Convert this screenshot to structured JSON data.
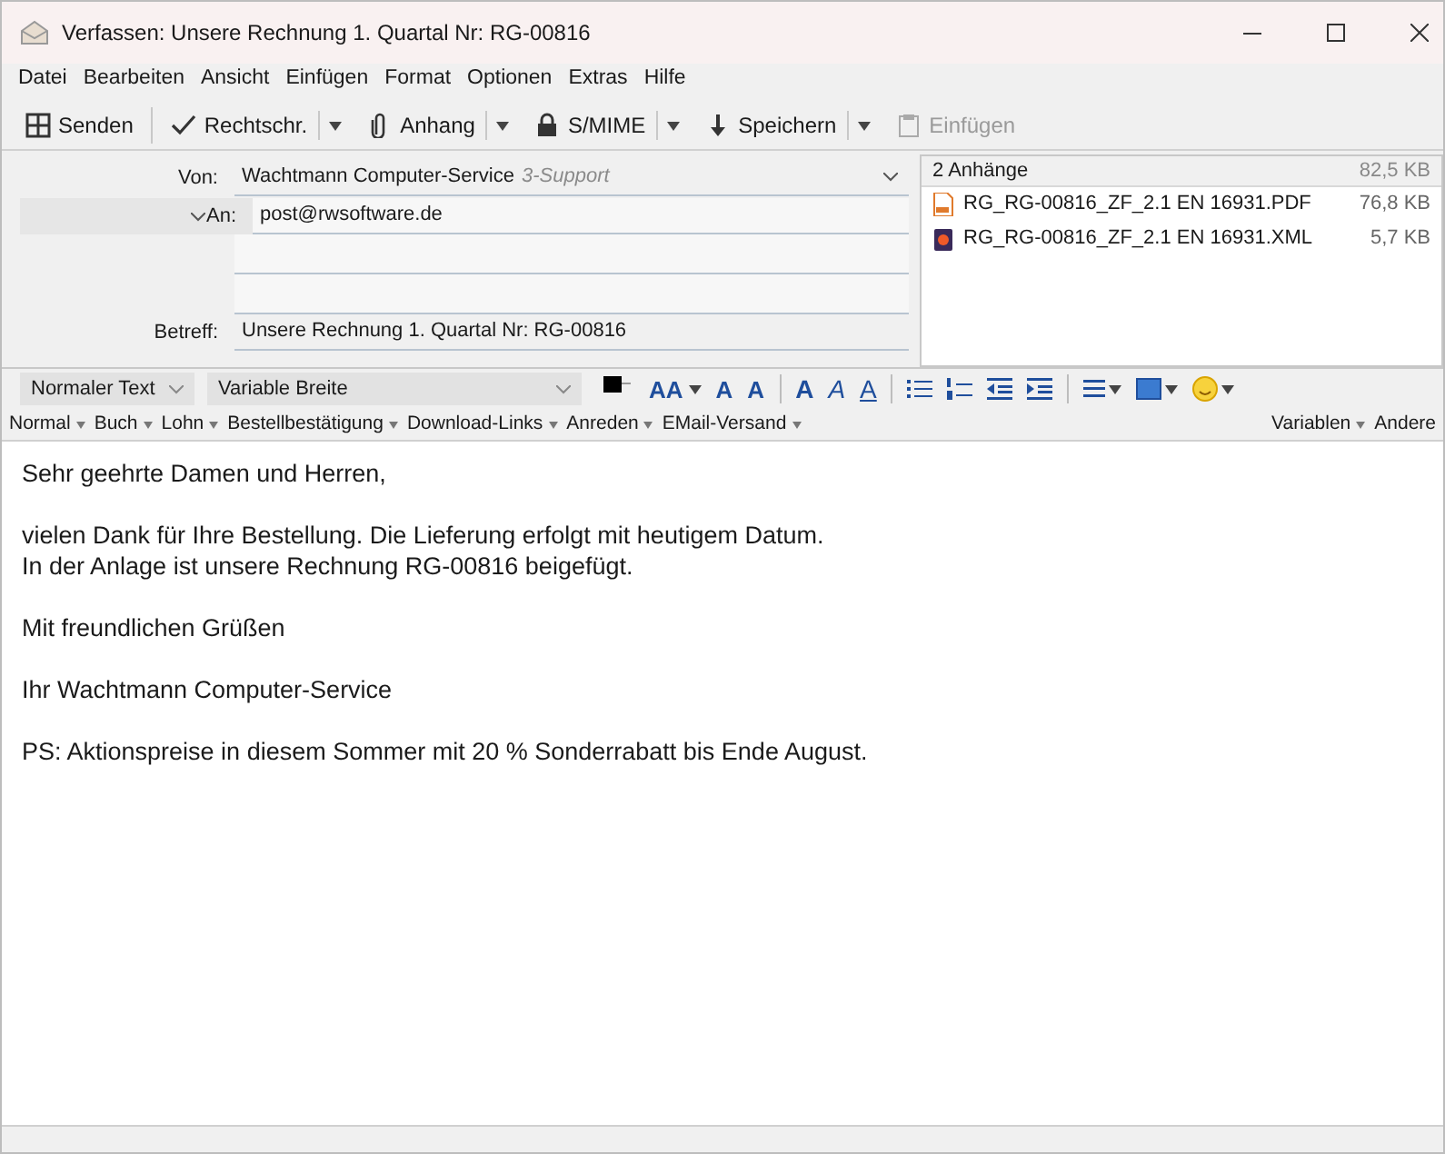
{
  "window": {
    "title": "Verfassen: Unsere Rechnung 1. Quartal Nr: RG-00816"
  },
  "menu": [
    "Datei",
    "Bearbeiten",
    "Ansicht",
    "Einfügen",
    "Format",
    "Optionen",
    "Extras",
    "Hilfe"
  ],
  "toolbar": [
    {
      "kind": "send",
      "label": "Senden",
      "dropdown": false,
      "disabled": false
    },
    {
      "kind": "spell",
      "label": "Rechtschr.",
      "dropdown": true,
      "disabled": false
    },
    {
      "kind": "attach",
      "label": "Anhang",
      "dropdown": true,
      "disabled": false
    },
    {
      "kind": "lock",
      "label": "S/MIME",
      "dropdown": true,
      "disabled": false
    },
    {
      "kind": "save",
      "label": "Speichern",
      "dropdown": true,
      "disabled": false
    },
    {
      "kind": "paste",
      "label": "Einfügen",
      "dropdown": false,
      "disabled": true
    }
  ],
  "header": {
    "from_label": "Von:",
    "from": "Wachtmann Computer-Service",
    "from_identity": "3-Support",
    "to_label": "An:",
    "to": "post@rwsoftware.de",
    "subject_label": "Betreff:",
    "subject": "Unsere Rechnung 1. Quartal Nr: RG-00816"
  },
  "attachments": {
    "title": "2 Anhänge",
    "total": "82,5 KB",
    "items": [
      {
        "kind": "pdf",
        "name": "RG_RG-00816_ZF_2.1 EN 16931.PDF",
        "size": "76,8 KB"
      },
      {
        "kind": "xml",
        "name": "RG_RG-00816_ZF_2.1 EN 16931.XML",
        "size": "5,7 KB"
      }
    ]
  },
  "format_bar": {
    "paragraph": "Normaler Text",
    "font": "Variable Breite",
    "tools": [
      {
        "kind": "color"
      },
      {
        "kind": "glyph",
        "glyph": "AA",
        "dropdown": true
      },
      {
        "kind": "glyph",
        "glyph": "A",
        "dropdown": false
      },
      {
        "kind": "glyph",
        "glyph": "A",
        "dropdown": false
      },
      {
        "kind": "sep"
      },
      {
        "kind": "bold",
        "glyph": "A"
      },
      {
        "kind": "italic",
        "glyph": "A"
      },
      {
        "kind": "underline",
        "glyph": "A"
      },
      {
        "kind": "sep"
      },
      {
        "kind": "bullets"
      },
      {
        "kind": "numbers"
      },
      {
        "kind": "outdent"
      },
      {
        "kind": "indent"
      },
      {
        "kind": "sep"
      },
      {
        "kind": "align"
      },
      {
        "kind": "image"
      },
      {
        "kind": "emoji"
      }
    ]
  },
  "templates": {
    "items": [
      "Normal",
      "Buch",
      "Lohn",
      "Bestellbestätigung",
      "Download-Links",
      "Anreden",
      "EMail-Versand"
    ],
    "right": [
      "Variablen",
      "Andere"
    ]
  },
  "body": [
    "Sehr geehrte Damen und Herren,",
    "vielen Dank für Ihre Bestellung. Die Lieferung erfolgt mit heutigem Datum.\nIn der Anlage ist unsere Rechnung RG-00816 beigefügt.",
    "Mit freundlichen Grüßen",
    "Ihr Wachtmann Computer-Service",
    "PS: Aktionspreise in diesem Sommer mit 20 % Sonderrabatt bis Ende August."
  ]
}
